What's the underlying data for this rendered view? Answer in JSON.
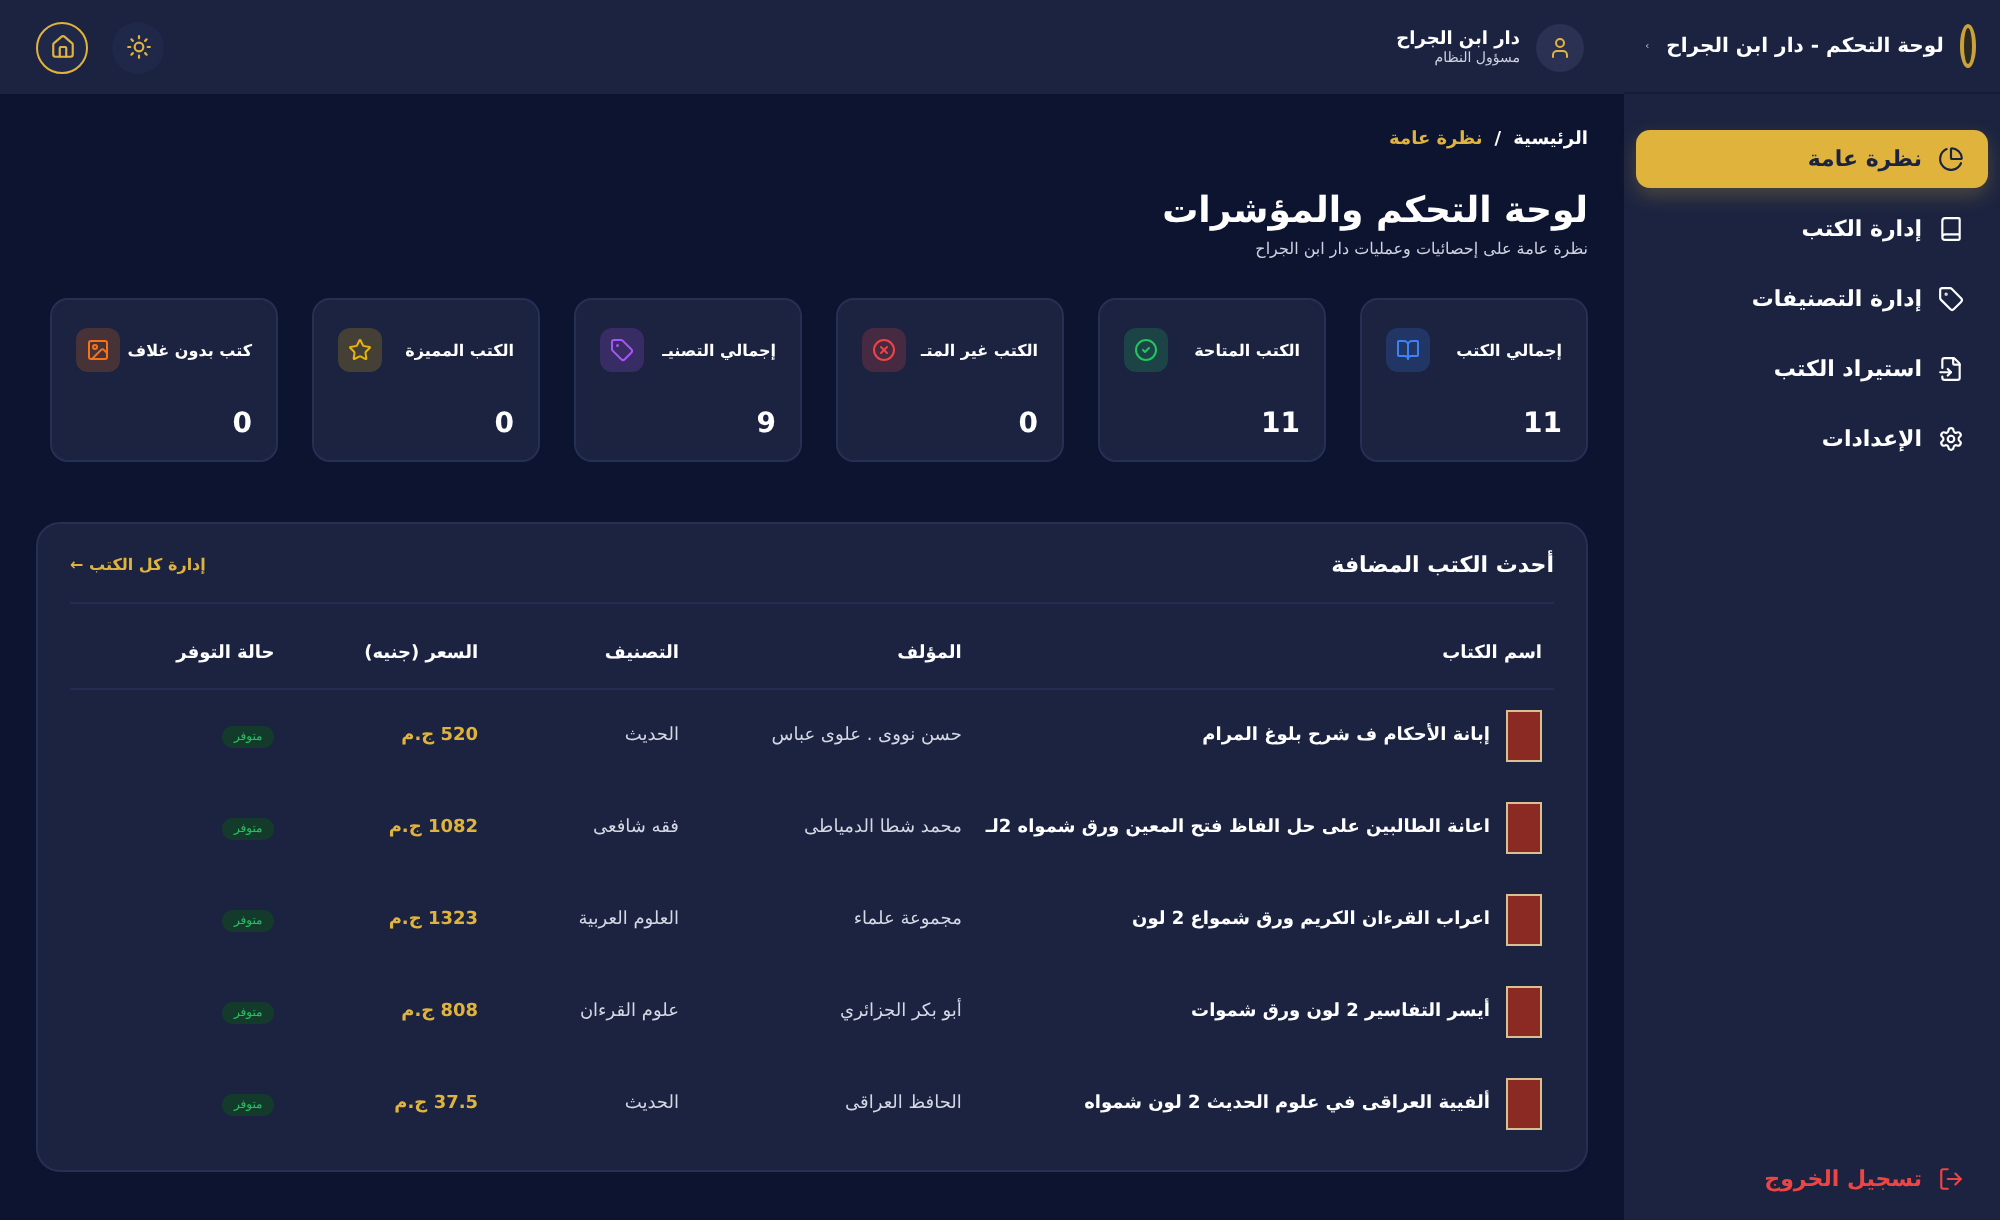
{
  "sidebar": {
    "title": "لوحة التحكم - دار ابن الجراح",
    "items": [
      {
        "kind": "overview",
        "label": "نظرة عامة",
        "selected": true
      },
      {
        "kind": "books",
        "label": "إدارة الكتب",
        "selected": false
      },
      {
        "kind": "categories",
        "label": "إدارة التصنيفات",
        "selected": false
      },
      {
        "kind": "import",
        "label": "استيراد الكتب",
        "selected": false
      },
      {
        "kind": "settings",
        "label": "الإعدادات",
        "selected": false
      }
    ],
    "logout": "تسجيل الخروج"
  },
  "header": {
    "user_name": "دار ابن الجراح",
    "user_role": "مسؤول النظام"
  },
  "breadcrumb": {
    "home": "الرئيسية",
    "separator": "/",
    "current": "نظرة عامة"
  },
  "page": {
    "title": "لوحة التحكم والمؤشرات",
    "subtitle": "نظرة عامة على إحصائيات وعمليات دار ابن الجراح"
  },
  "stats": [
    {
      "kind": "book",
      "label": "إجمالي الكتب",
      "value": "11",
      "color": "#3b82f6"
    },
    {
      "kind": "check",
      "label": "الكتب المتاحة",
      "value": "11",
      "color": "#22c55e"
    },
    {
      "kind": "cross",
      "label": "الكتب غير المتـ",
      "value": "0",
      "color": "#ef4444"
    },
    {
      "kind": "tag",
      "label": "إجمالي التصنيـ",
      "value": "9",
      "color": "#a855f7"
    },
    {
      "kind": "star",
      "label": "الكتب المميزة",
      "value": "0",
      "color": "#eab308"
    },
    {
      "kind": "image",
      "label": "كتب بدون غلاف",
      "value": "0",
      "color": "#f97316"
    }
  ],
  "recent": {
    "title": "أحدث الكتب المضافة",
    "link": "إدارة كل الكتب ←",
    "columns": [
      "اسم الكتاب",
      "المؤلف",
      "التصنيف",
      "السعر (جنيه)",
      "حالة التوفر"
    ],
    "rows": [
      {
        "title": "إبانة الأحكام ف شرح بلوغ المرام",
        "author": "حسن نووى . علوى عباس",
        "category": "الحديث",
        "price": "520 ج.م",
        "status": "متوفر"
      },
      {
        "title": "اعانة الطالبين على حل الفاظ فتح المعين ورق شمواه 2لـ",
        "author": "محمد شطا الدمياطى",
        "category": "فقه شافعى",
        "price": "1082 ج.م",
        "status": "متوفر"
      },
      {
        "title": "اعراب القرءان الكريم ورق شمواع 2 لون",
        "author": "مجموعة علماء",
        "category": "العلوم العربية",
        "price": "1323 ج.م",
        "status": "متوفر"
      },
      {
        "title": "أيسر التفاسير 2 لون ورق شموات",
        "author": "أبو بكر الجزائري",
        "category": "علوم القرءان",
        "price": "808 ج.م",
        "status": "متوفر"
      },
      {
        "title": "ألفيية العراقى في علوم الحديث 2 لون شمواه",
        "author": "الحافظ العراقى",
        "category": "الحديث",
        "price": "37.5 ج.م",
        "status": "متوفر"
      }
    ]
  }
}
